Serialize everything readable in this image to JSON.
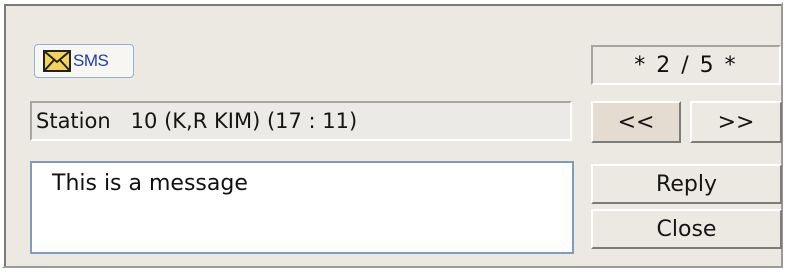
{
  "sms_button": {
    "label": "SMS",
    "icon": "envelope-icon"
  },
  "counter": {
    "text": "* 2 / 5 *"
  },
  "station": {
    "text": "Station   10 (K,R KIM) (17 : 11)"
  },
  "nav": {
    "prev_label": "<<",
    "next_label": ">>"
  },
  "message": {
    "text": "This is a message"
  },
  "actions": {
    "reply_label": "Reply",
    "close_label": "Close"
  },
  "colors": {
    "sms_text": "#1f3ea6",
    "envelope": "#f4d35a",
    "message_border": "#7f9db9"
  }
}
